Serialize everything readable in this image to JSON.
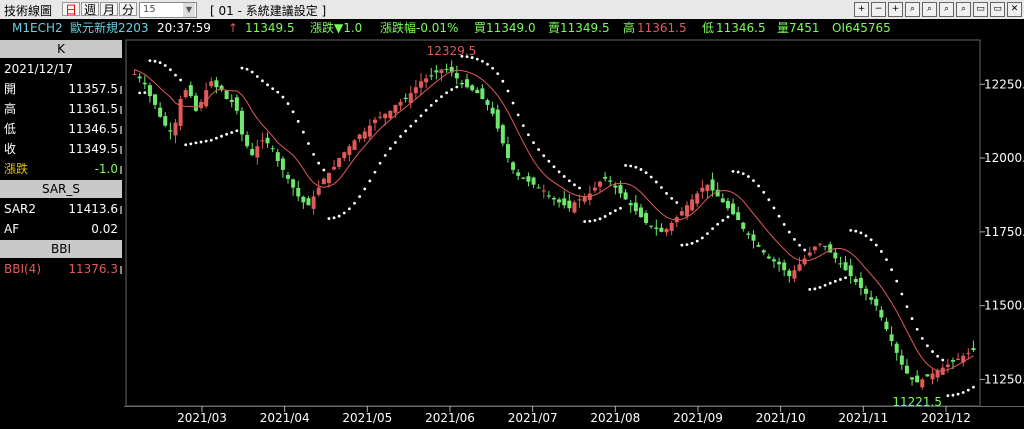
{
  "titlebar": {
    "app_title": "技術線圖",
    "periods": [
      "日",
      "週",
      "月",
      "分"
    ],
    "selected_period": "日",
    "minute_value": "15",
    "setting_title": "[ 01 - 系統建議設定 ]",
    "buttons": [
      "+",
      "−",
      "+",
      "⌕",
      "⌕",
      "⌕",
      "⌕",
      "▭",
      "▭",
      "✕"
    ]
  },
  "quote": {
    "symbol": "M1ECH2",
    "name": "歐元新規2203",
    "time": "20:37:59",
    "arrow": "↑",
    "last": "11349.5",
    "change_label": "漲跌▼1.0",
    "change_pct_label": "漲跌幅-0.01%",
    "bid_label": "買11349.0",
    "ask_label": "賣11349.5",
    "high_label_text": "高",
    "high_value": "11361.5",
    "low_label_text": "低",
    "low_value": "11346.5",
    "volume_label": "量7451",
    "oi_label": "OI645765"
  },
  "panel": {
    "k_header": "K",
    "date": "2021/12/17",
    "rows": [
      {
        "label": "開",
        "value": "11357.5",
        "color": "#ffffff"
      },
      {
        "label": "高",
        "value": "11361.5",
        "color": "#ffffff"
      },
      {
        "label": "低",
        "value": "11346.5",
        "color": "#ffffff"
      },
      {
        "label": "收",
        "value": "11349.5",
        "color": "#ffffff"
      },
      {
        "label": "漲跌",
        "value": "-1.0",
        "color": "#7cfc5a"
      }
    ],
    "sar_header": "SAR_S",
    "sar_rows": [
      {
        "label": "SAR2",
        "value": "11413.6"
      },
      {
        "label": "AF",
        "value": "0.02"
      }
    ],
    "bbi_header": "BBI",
    "bbi_row": {
      "label": "BBI(4)",
      "value": "11376.3"
    }
  },
  "chart_data": {
    "type": "candlestick",
    "x_tick_labels": [
      "2021/03",
      "2021/04",
      "2021/05",
      "2021/06",
      "2021/07",
      "2021/08",
      "2021/09",
      "2021/10",
      "2021/11",
      "2021/12"
    ],
    "y_ticks": [
      11250,
      11500,
      11750,
      12000,
      12250
    ],
    "y_tick_labels": [
      "11250.",
      "11500.",
      "11750.",
      "12000.",
      "12250."
    ],
    "ylim": [
      11160,
      12400
    ],
    "annotations": [
      {
        "text": "12329.5",
        "value": 12329.5,
        "color": "#e05a5a"
      },
      {
        "text": "11221.5",
        "value": 11221.5,
        "color": "#7cfc5a"
      }
    ],
    "up_color": "#e05a5a",
    "down_color": "#6ee86e",
    "sar_color": "#ffffff",
    "bbi_color": "#e05a5a",
    "closes": [
      12285,
      12270,
      12250,
      12210,
      12180,
      12140,
      12110,
      12090,
      12120,
      12200,
      12230,
      12210,
      12160,
      12190,
      12230,
      12260,
      12240,
      12230,
      12200,
      12190,
      12160,
      12080,
      12040,
      12010,
      12040,
      12060,
      12050,
      12030,
      11990,
      11960,
      11930,
      11900,
      11870,
      11850,
      11840,
      11870,
      11900,
      11930,
      11950,
      11970,
      12000,
      12020,
      12040,
      12060,
      12080,
      12090,
      12110,
      12130,
      12140,
      12150,
      12160,
      12180,
      12190,
      12200,
      12220,
      12240,
      12260,
      12270,
      12280,
      12290,
      12300,
      12300,
      12290,
      12270,
      12250,
      12240,
      12230,
      12220,
      12200,
      12180,
      12150,
      12100,
      12050,
      12000,
      11960,
      11940,
      11930,
      11920,
      11910,
      11900,
      11890,
      11870,
      11860,
      11850,
      11840,
      11830,
      11850,
      11860,
      11870,
      11880,
      11900,
      11920,
      11930,
      11920,
      11900,
      11880,
      11860,
      11840,
      11820,
      11800,
      11780,
      11770,
      11760,
      11750,
      11760,
      11780,
      11800,
      11820,
      11840,
      11860,
      11880,
      11900,
      11910,
      11890,
      11870,
      11850,
      11830,
      11810,
      11790,
      11760,
      11740,
      11720,
      11700,
      11680,
      11660,
      11650,
      11640,
      11620,
      11600,
      11620,
      11640,
      11660,
      11680,
      11700,
      11710,
      11700,
      11680,
      11660,
      11640,
      11620,
      11600,
      11580,
      11560,
      11540,
      11520,
      11500,
      11460,
      11420,
      11380,
      11340,
      11300,
      11270,
      11250,
      11240,
      11250,
      11260,
      11270,
      11280,
      11290,
      11300,
      11310,
      11320,
      11330,
      11340,
      11349.5
    ]
  }
}
